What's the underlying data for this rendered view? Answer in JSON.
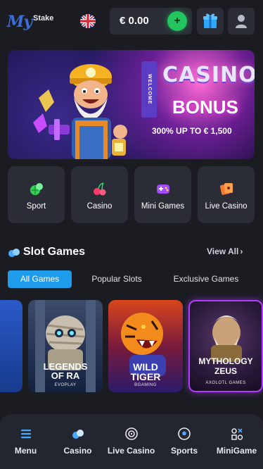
{
  "header": {
    "logo_my": "My",
    "logo_stake": "Stake",
    "balance": "€ 0.00",
    "deposit_symbol": "+",
    "icons": [
      "uk-flag-icon",
      "plus-icon",
      "gift-icon",
      "user-icon"
    ]
  },
  "banner": {
    "welcome": "WELCOME",
    "title": "CASINO",
    "subtitle": "BONUS",
    "offer": "300% UP TO € 1,500"
  },
  "categories": [
    {
      "label": "Sport",
      "icon": "sport-icon"
    },
    {
      "label": "Casino",
      "icon": "casino-cherry-icon"
    },
    {
      "label": "Mini Games",
      "icon": "gamepad-icon"
    },
    {
      "label": "Live Casino",
      "icon": "live-casino-icon"
    }
  ],
  "slot_section": {
    "title": "Slot Games",
    "view_all": "View All",
    "tabs": [
      "All Games",
      "Popular Slots",
      "Exclusive Games"
    ],
    "active_tab": "All Games"
  },
  "games": [
    {
      "title_line1": "LEGENDS",
      "title_line2": "OF RA",
      "provider": "EVOPLAY"
    },
    {
      "title_line1": "WILD",
      "title_line2": "TIGER",
      "provider": "BGAMING"
    },
    {
      "title_line1": "MYTHOLOGY",
      "title_line2": "ZEUS",
      "provider": "AXOLOTL GAMES"
    }
  ],
  "bottom_nav": [
    {
      "label": "Menu",
      "icon": "menu-icon"
    },
    {
      "label": "Casino",
      "icon": "casino-icon"
    },
    {
      "label": "Live Casino",
      "icon": "roulette-icon"
    },
    {
      "label": "Sports",
      "icon": "soccer-ball-icon"
    },
    {
      "label": "MiniGame",
      "icon": "minigame-icon"
    }
  ],
  "colors": {
    "background": "#1a1c22",
    "card": "#2a2d36",
    "accent_blue": "#1e9bea",
    "deposit_green": "#22c55e"
  }
}
